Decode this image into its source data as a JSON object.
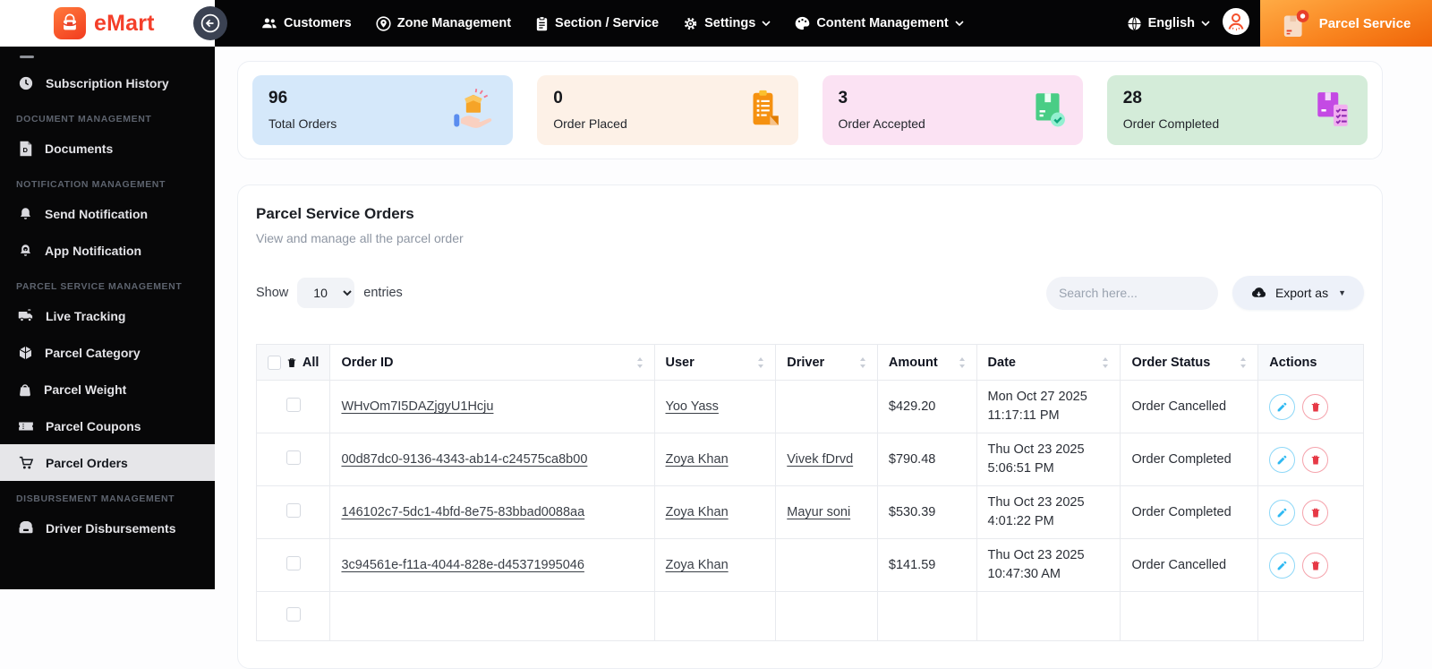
{
  "navbar": {
    "brand": "eMart",
    "items": [
      {
        "label": "Customers",
        "icon": "users-icon"
      },
      {
        "label": "Zone Management",
        "icon": "location-icon"
      },
      {
        "label": "Section / Service",
        "icon": "clipboard-icon"
      },
      {
        "label": "Settings",
        "icon": "gear-icon",
        "has_dropdown": true
      },
      {
        "label": "Content Management",
        "icon": "palette-icon",
        "has_dropdown": true
      }
    ],
    "language": "English",
    "service_label": "Parcel Service"
  },
  "sidebar": {
    "subscription_history": "Subscription History",
    "section_document": "DOCUMENT MANAGEMENT",
    "documents": "Documents",
    "section_notification": "NOTIFICATION MANAGEMENT",
    "send_notification": "Send Notification",
    "app_notification": "App Notification",
    "section_parcel": "PARCEL SERVICE MANAGEMENT",
    "live_tracking": "Live Tracking",
    "parcel_category": "Parcel Category",
    "parcel_weight": "Parcel Weight",
    "parcel_coupons": "Parcel Coupons",
    "parcel_orders": "Parcel Orders",
    "section_disbursement": "DISBURSEMENT MANAGEMENT",
    "driver_disbursements": "Driver Disbursements",
    "active_item": "Parcel Orders"
  },
  "stats": {
    "cards": [
      {
        "value": "96",
        "label": "Total Orders",
        "bg": "#d5e8fa",
        "icon": "box-hand-icon"
      },
      {
        "value": "0",
        "label": "Order Placed",
        "bg": "#fdf1e7",
        "icon": "order-clipboard-icon"
      },
      {
        "value": "3",
        "label": "Order Accepted",
        "bg": "#fbe2f3",
        "icon": "package-check-icon"
      },
      {
        "value": "28",
        "label": "Order Completed",
        "bg": "#d4ecd9",
        "icon": "package-checklist-icon"
      }
    ]
  },
  "orders_panel": {
    "title": "Parcel Service Orders",
    "subtitle": "View and manage all the parcel order",
    "show_label": "Show",
    "page_size": "10",
    "entries_label": "entries",
    "search_placeholder": "Search here...",
    "export_label": "Export as",
    "table": {
      "select_all_label": "All",
      "columns": [
        "Order ID",
        "User",
        "Driver",
        "Amount",
        "Date",
        "Order Status",
        "Actions"
      ],
      "rows": [
        {
          "order_id": "WHvOm7I5DAZjgyU1Hcju",
          "user": "Yoo Yass",
          "driver": "",
          "amount": "$429.20",
          "date_line1": "Mon Oct 27 2025",
          "date_line2": "11:17:11 PM",
          "status": "Order Cancelled"
        },
        {
          "order_id": "00d87dc0-9136-4343-ab14-c24575ca8b00",
          "user": "Zoya Khan",
          "driver": "Vivek fDrvd",
          "amount": "$790.48",
          "date_line1": "Thu Oct 23 2025",
          "date_line2": "5:06:51 PM",
          "status": "Order Completed"
        },
        {
          "order_id": "146102c7-5dc1-4bfd-8e75-83bbad0088aa",
          "user": "Zoya Khan",
          "driver": "Mayur soni",
          "amount": "$530.39",
          "date_line1": "Thu Oct 23 2025",
          "date_line2": "4:01:22 PM",
          "status": "Order Completed"
        },
        {
          "order_id": "3c94561e-f11a-4044-828e-d45371995046",
          "user": "Zoya Khan",
          "driver": "",
          "amount": "$141.59",
          "date_line1": "Thu Oct 23 2025",
          "date_line2": "10:47:30 AM",
          "status": "Order Cancelled"
        }
      ]
    }
  },
  "colors": {
    "brand_red": "#f43f2a",
    "navbar_black": "#050506",
    "accent_orange_gradient": [
      "#ffab45",
      "#ef6408"
    ],
    "edit_blue": "#2fb9f2",
    "delete_red": "#e63946",
    "card_blue": "#d5e8fa",
    "card_peach": "#fdf1e7",
    "card_pink": "#fbe2f3",
    "card_green": "#d4ecd9"
  }
}
